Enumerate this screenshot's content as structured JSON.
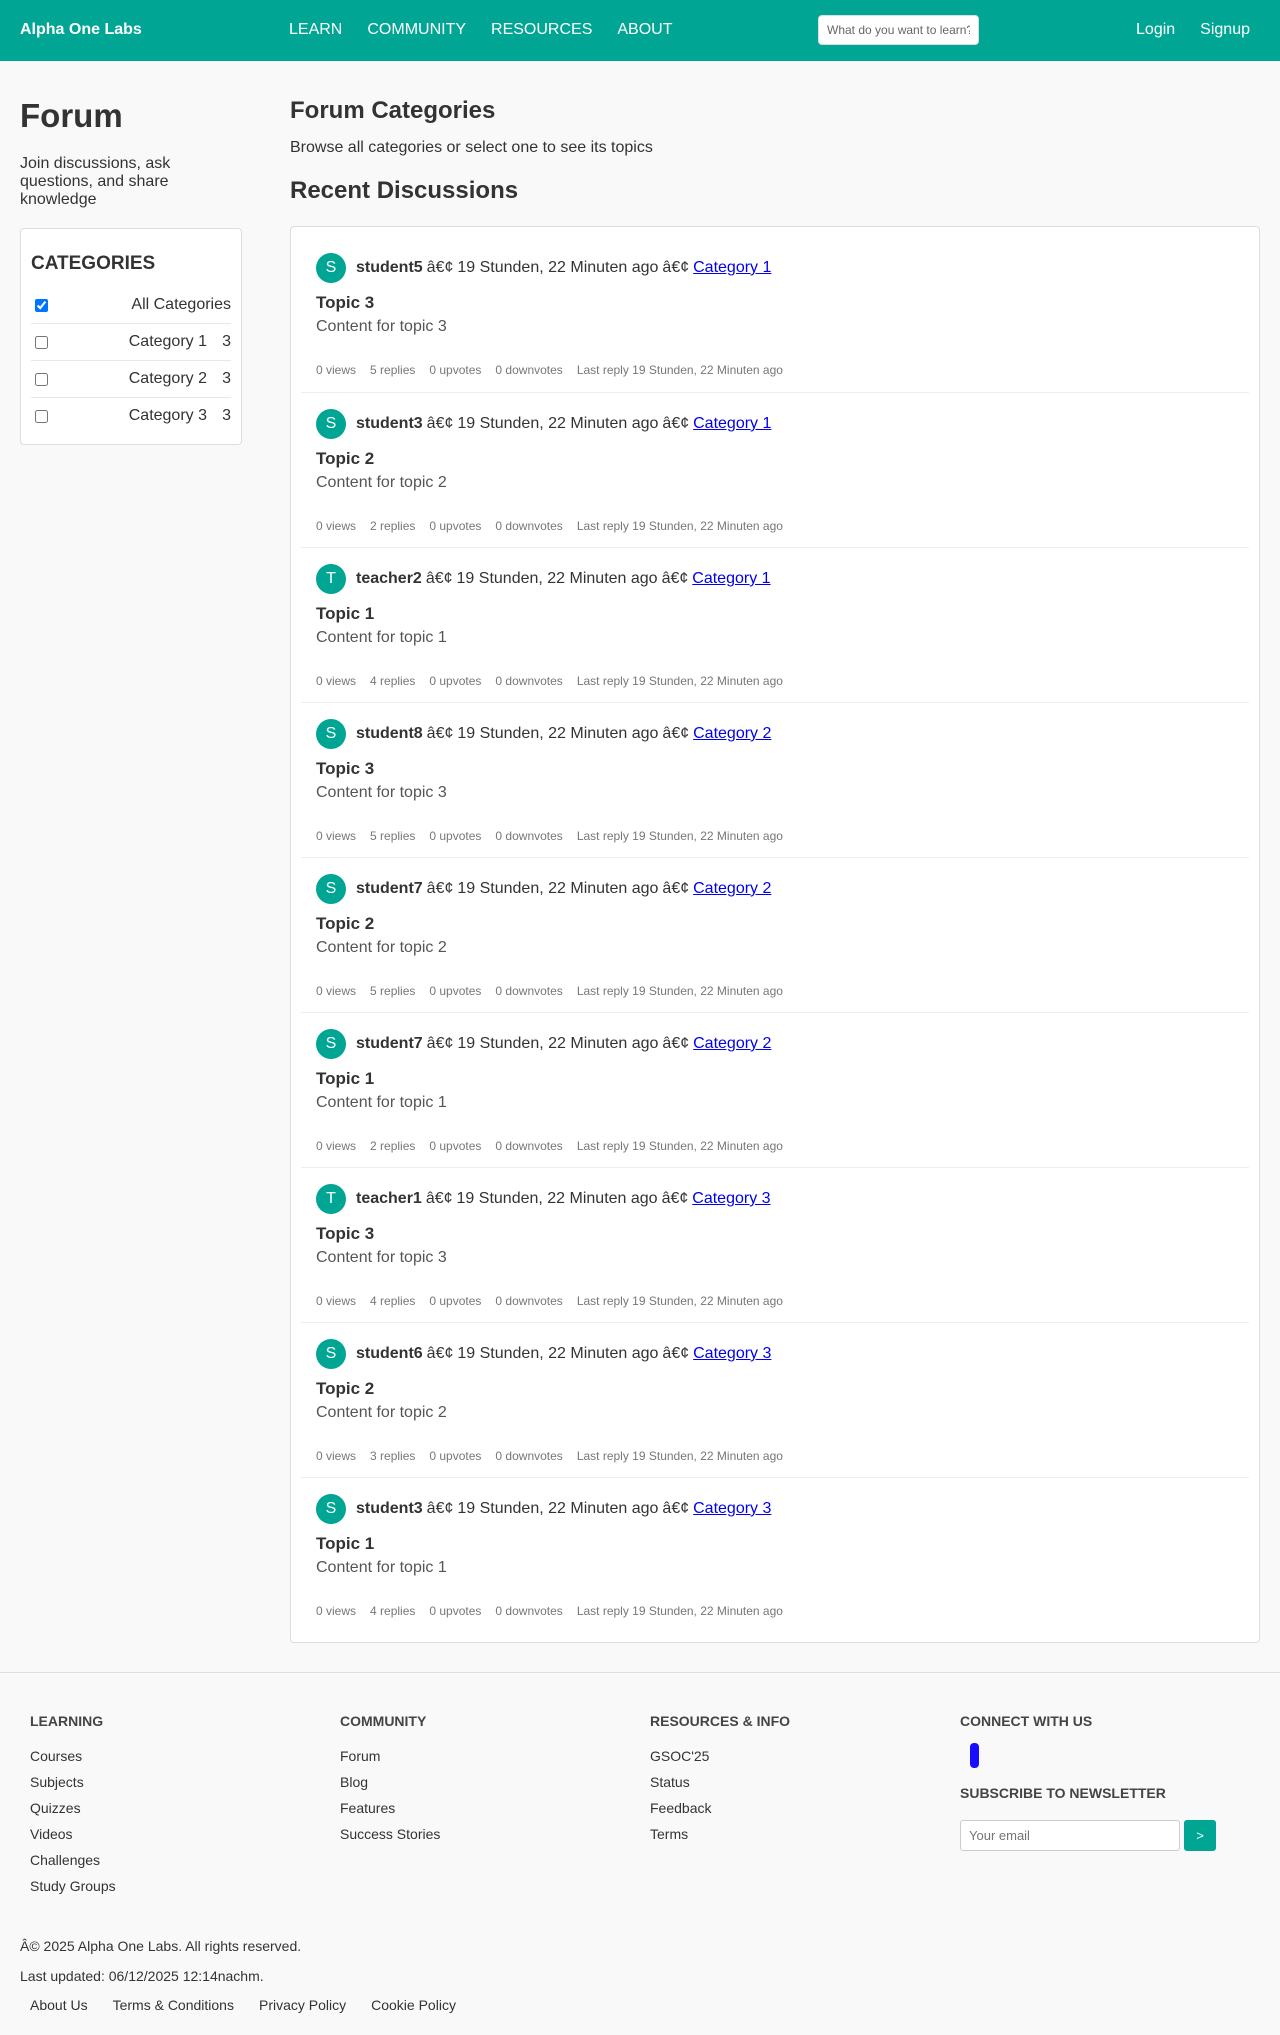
{
  "header": {
    "brand": "Alpha One Labs",
    "nav": [
      "LEARN",
      "COMMUNITY",
      "RESOURCES",
      "ABOUT"
    ],
    "search_placeholder": "What do you want to learn?",
    "login": "Login",
    "signup": "Signup"
  },
  "sidebar": {
    "title": "Forum",
    "intro": "Join discussions, ask questions, and share knowledge",
    "categories_heading": "CATEGORIES",
    "categories": [
      {
        "label": "All Categories",
        "count": "",
        "checked": true
      },
      {
        "label": "Category 1",
        "count": "3",
        "checked": false
      },
      {
        "label": "Category 2",
        "count": "3",
        "checked": false
      },
      {
        "label": "Category 3",
        "count": "3",
        "checked": false
      }
    ]
  },
  "main": {
    "heading": "Forum Categories",
    "subtitle": "Browse all categories or select one to see its topics",
    "recent_heading": "Recent Discussions",
    "separator": "â€¢",
    "posts": [
      {
        "initial": "S",
        "author": "student5",
        "time": "19 Stunden, 22 Minuten ago",
        "category": "Category 1",
        "title": "Topic 3",
        "body": "Content for topic 3",
        "views": "0 views",
        "replies": "5 replies",
        "upvotes": "0 upvotes",
        "downvotes": "0 downvotes",
        "last_reply": "Last reply 19 Stunden, 22 Minuten ago"
      },
      {
        "initial": "S",
        "author": "student3",
        "time": "19 Stunden, 22 Minuten ago",
        "category": "Category 1",
        "title": "Topic 2",
        "body": "Content for topic 2",
        "views": "0 views",
        "replies": "2 replies",
        "upvotes": "0 upvotes",
        "downvotes": "0 downvotes",
        "last_reply": "Last reply 19 Stunden, 22 Minuten ago"
      },
      {
        "initial": "T",
        "author": "teacher2",
        "time": "19 Stunden, 22 Minuten ago",
        "category": "Category 1",
        "title": "Topic 1",
        "body": "Content for topic 1",
        "views": "0 views",
        "replies": "4 replies",
        "upvotes": "0 upvotes",
        "downvotes": "0 downvotes",
        "last_reply": "Last reply 19 Stunden, 22 Minuten ago"
      },
      {
        "initial": "S",
        "author": "student8",
        "time": "19 Stunden, 22 Minuten ago",
        "category": "Category 2",
        "title": "Topic 3",
        "body": "Content for topic 3",
        "views": "0 views",
        "replies": "5 replies",
        "upvotes": "0 upvotes",
        "downvotes": "0 downvotes",
        "last_reply": "Last reply 19 Stunden, 22 Minuten ago"
      },
      {
        "initial": "S",
        "author": "student7",
        "time": "19 Stunden, 22 Minuten ago",
        "category": "Category 2",
        "title": "Topic 2",
        "body": "Content for topic 2",
        "views": "0 views",
        "replies": "5 replies",
        "upvotes": "0 upvotes",
        "downvotes": "0 downvotes",
        "last_reply": "Last reply 19 Stunden, 22 Minuten ago"
      },
      {
        "initial": "S",
        "author": "student7",
        "time": "19 Stunden, 22 Minuten ago",
        "category": "Category 2",
        "title": "Topic 1",
        "body": "Content for topic 1",
        "views": "0 views",
        "replies": "2 replies",
        "upvotes": "0 upvotes",
        "downvotes": "0 downvotes",
        "last_reply": "Last reply 19 Stunden, 22 Minuten ago"
      },
      {
        "initial": "T",
        "author": "teacher1",
        "time": "19 Stunden, 22 Minuten ago",
        "category": "Category 3",
        "title": "Topic 3",
        "body": "Content for topic 3",
        "views": "0 views",
        "replies": "4 replies",
        "upvotes": "0 upvotes",
        "downvotes": "0 downvotes",
        "last_reply": "Last reply 19 Stunden, 22 Minuten ago"
      },
      {
        "initial": "S",
        "author": "student6",
        "time": "19 Stunden, 22 Minuten ago",
        "category": "Category 3",
        "title": "Topic 2",
        "body": "Content for topic 2",
        "views": "0 views",
        "replies": "3 replies",
        "upvotes": "0 upvotes",
        "downvotes": "0 downvotes",
        "last_reply": "Last reply 19 Stunden, 22 Minuten ago"
      },
      {
        "initial": "S",
        "author": "student3",
        "time": "19 Stunden, 22 Minuten ago",
        "category": "Category 3",
        "title": "Topic 1",
        "body": "Content for topic 1",
        "views": "0 views",
        "replies": "4 replies",
        "upvotes": "0 upvotes",
        "downvotes": "0 downvotes",
        "last_reply": "Last reply 19 Stunden, 22 Minuten ago"
      }
    ]
  },
  "footer": {
    "learning": {
      "heading": "LEARNING",
      "links": [
        "Courses",
        "Subjects",
        "Quizzes",
        "Videos",
        "Challenges",
        "Study Groups"
      ]
    },
    "community": {
      "heading": "COMMUNITY",
      "links": [
        "Forum",
        "Blog",
        "Features",
        "Success Stories"
      ]
    },
    "resources": {
      "heading": "RESOURCES & INFO",
      "links": [
        "GSOC'25",
        "Status",
        "Feedback",
        "Terms"
      ]
    },
    "connect": {
      "heading": "CONNECT WITH US",
      "social_icon": "social-link-icon",
      "social_color": "#1a0dff"
    },
    "newsletter": {
      "heading": "SUBSCRIBE TO NEWSLETTER",
      "placeholder": "Your email",
      "button": ">"
    },
    "copyright": "Â© 2025 Alpha One Labs. All rights reserved.",
    "updated": "Last updated: 06/12/2025 12:14nachm.",
    "legal": [
      "About Us",
      "Terms & Conditions",
      "Privacy Policy",
      "Cookie Policy"
    ]
  },
  "colors": {
    "accent": "#00a693",
    "link": "#0000ee"
  }
}
